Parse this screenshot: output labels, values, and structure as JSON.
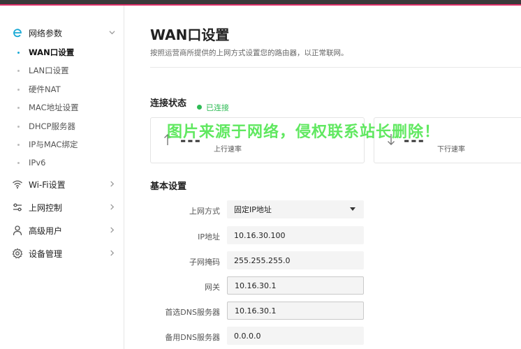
{
  "sidebar": {
    "groups": [
      {
        "label": "网络参数",
        "icon": "e-icon",
        "expanded": true
      },
      {
        "label": "Wi-Fi设置",
        "icon": "wifi-icon"
      },
      {
        "label": "上网控制",
        "icon": "sliders-icon"
      },
      {
        "label": "高级用户",
        "icon": "user-icon"
      },
      {
        "label": "设备管理",
        "icon": "gear-icon"
      }
    ],
    "sub_items": [
      {
        "label": "WAN口设置",
        "active": true
      },
      {
        "label": "LAN口设置"
      },
      {
        "label": "硬件NAT"
      },
      {
        "label": "MAC地址设置"
      },
      {
        "label": "DHCP服务器"
      },
      {
        "label": "IP与MAC绑定"
      },
      {
        "label": "IPv6"
      }
    ]
  },
  "main": {
    "title": "WAN口设置",
    "description": "按照运营商所提供的上网方式设置您的路由器，以正常联网。",
    "connection": {
      "section_title": "连接状态",
      "status_text": "已连接",
      "status_color": "#2ebb55",
      "upload": {
        "value": "---",
        "label": "上行速率"
      },
      "download": {
        "value": "---",
        "label": "下行速率"
      }
    },
    "watermark": "图片来源于网络，侵权联系站长删除！",
    "basic": {
      "section_title": "基本设置",
      "fields": [
        {
          "label": "上网方式",
          "value": "固定IP地址",
          "type": "select"
        },
        {
          "label": "IP地址",
          "value": "10.16.30.100"
        },
        {
          "label": "子网掩码",
          "value": "255.255.255.0"
        },
        {
          "label": "网关",
          "value": "10.16.30.1"
        },
        {
          "label": "首选DNS服务器",
          "value": "10.16.30.1"
        },
        {
          "label": "备用DNS服务器",
          "value": "0.0.0.0"
        }
      ]
    }
  },
  "colors": {
    "accent": "#19a9d5",
    "topbar_accent": "#e0306a"
  }
}
